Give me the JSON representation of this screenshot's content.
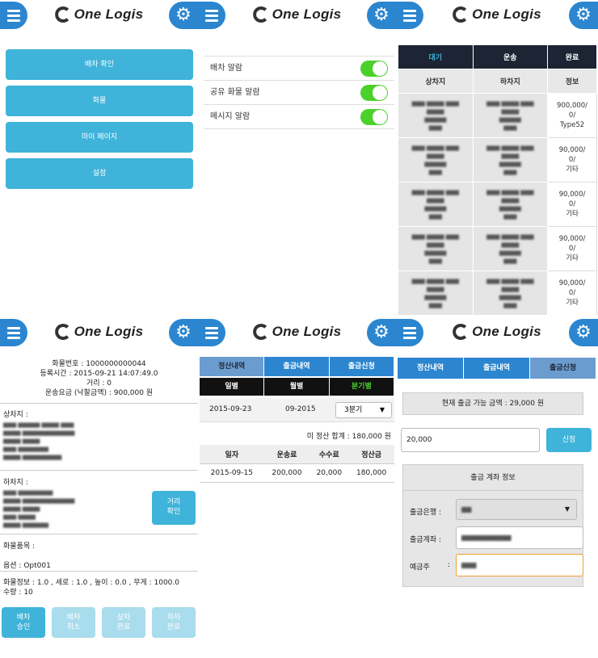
{
  "header": {
    "logo_text": "One Logis"
  },
  "main_menu": {
    "items": [
      "배차 확인",
      "화물",
      "마이 페이지",
      "설정"
    ]
  },
  "settings": {
    "items": [
      {
        "label": "배차 알람",
        "on": true
      },
      {
        "label": "공유 화물 알람",
        "on": true
      },
      {
        "label": "메시지 알람",
        "on": true
      }
    ]
  },
  "dispatch_list": {
    "tabs": [
      "대기",
      "운송",
      "완료"
    ],
    "headers": [
      "상차지",
      "하차지",
      "정보"
    ],
    "rows": [
      {
        "info": [
          "900,000/",
          "0/",
          "Type52"
        ]
      },
      {
        "info": [
          "90,000/",
          "0/",
          "기타"
        ]
      },
      {
        "info": [
          "90,000/",
          "0/",
          "기타"
        ]
      },
      {
        "info": [
          "90,000/",
          "0/",
          "기타"
        ]
      },
      {
        "info": [
          "90,000/",
          "0/",
          "기타"
        ]
      }
    ]
  },
  "detail": {
    "cargo_no": "화물번호 : 1000000000044",
    "reg_time": "등록시간 : 2015-09-21 14:07:49.0",
    "distance": "거리 : 0",
    "fee": "운송요금 (낙찰금액) : 900,000 원",
    "pickup_label": "상차지 :",
    "dropoff_label": "하차지 :",
    "distance_button": [
      "거리",
      "확인"
    ],
    "item_label": "화물품목 :",
    "option": "옵션 : Opt001",
    "cargo_info": "화물정보 : 1.0 , 세로 : 1.0 , 높이 : 0.0 , 무게 : 1000.0",
    "quantity": "수량 : 10",
    "actions": [
      [
        "배차",
        "승인"
      ],
      [
        "배차",
        "취소"
      ],
      [
        "상차",
        "완료"
      ],
      [
        "하차",
        "완료"
      ]
    ]
  },
  "settlement": {
    "tabs": [
      "정산내역",
      "출금내역",
      "출금신청"
    ],
    "period_tabs": [
      "일별",
      "월별",
      "분기별"
    ],
    "date_value": "2015-09-23",
    "month_value": "09-2015",
    "quarter_value": "3분기",
    "unsettled_total": "미 정산 합계 : 180,000 원",
    "columns": [
      "일자",
      "운송료",
      "수수료",
      "정산금"
    ],
    "rows": [
      [
        "2015-09-15",
        "200,000",
        "20,000",
        "180,000"
      ]
    ]
  },
  "withdraw": {
    "tabs": [
      "정산내역",
      "출금내역",
      "출금신청"
    ],
    "available": "현재 출금 가능 금액 : 29,000 원",
    "amount_value": "20,000",
    "apply_button": "신청",
    "account_title": "출금 계좌 정보",
    "bank_label": "출금은행 :",
    "account_label": "출금계좌 :",
    "holder_label": "예금주",
    "holder_colon": ":"
  },
  "colors": {
    "primary": "#2b86cf",
    "button": "#3fb3d9",
    "dark": "#1d2433",
    "toggle": "#4cd12c"
  }
}
